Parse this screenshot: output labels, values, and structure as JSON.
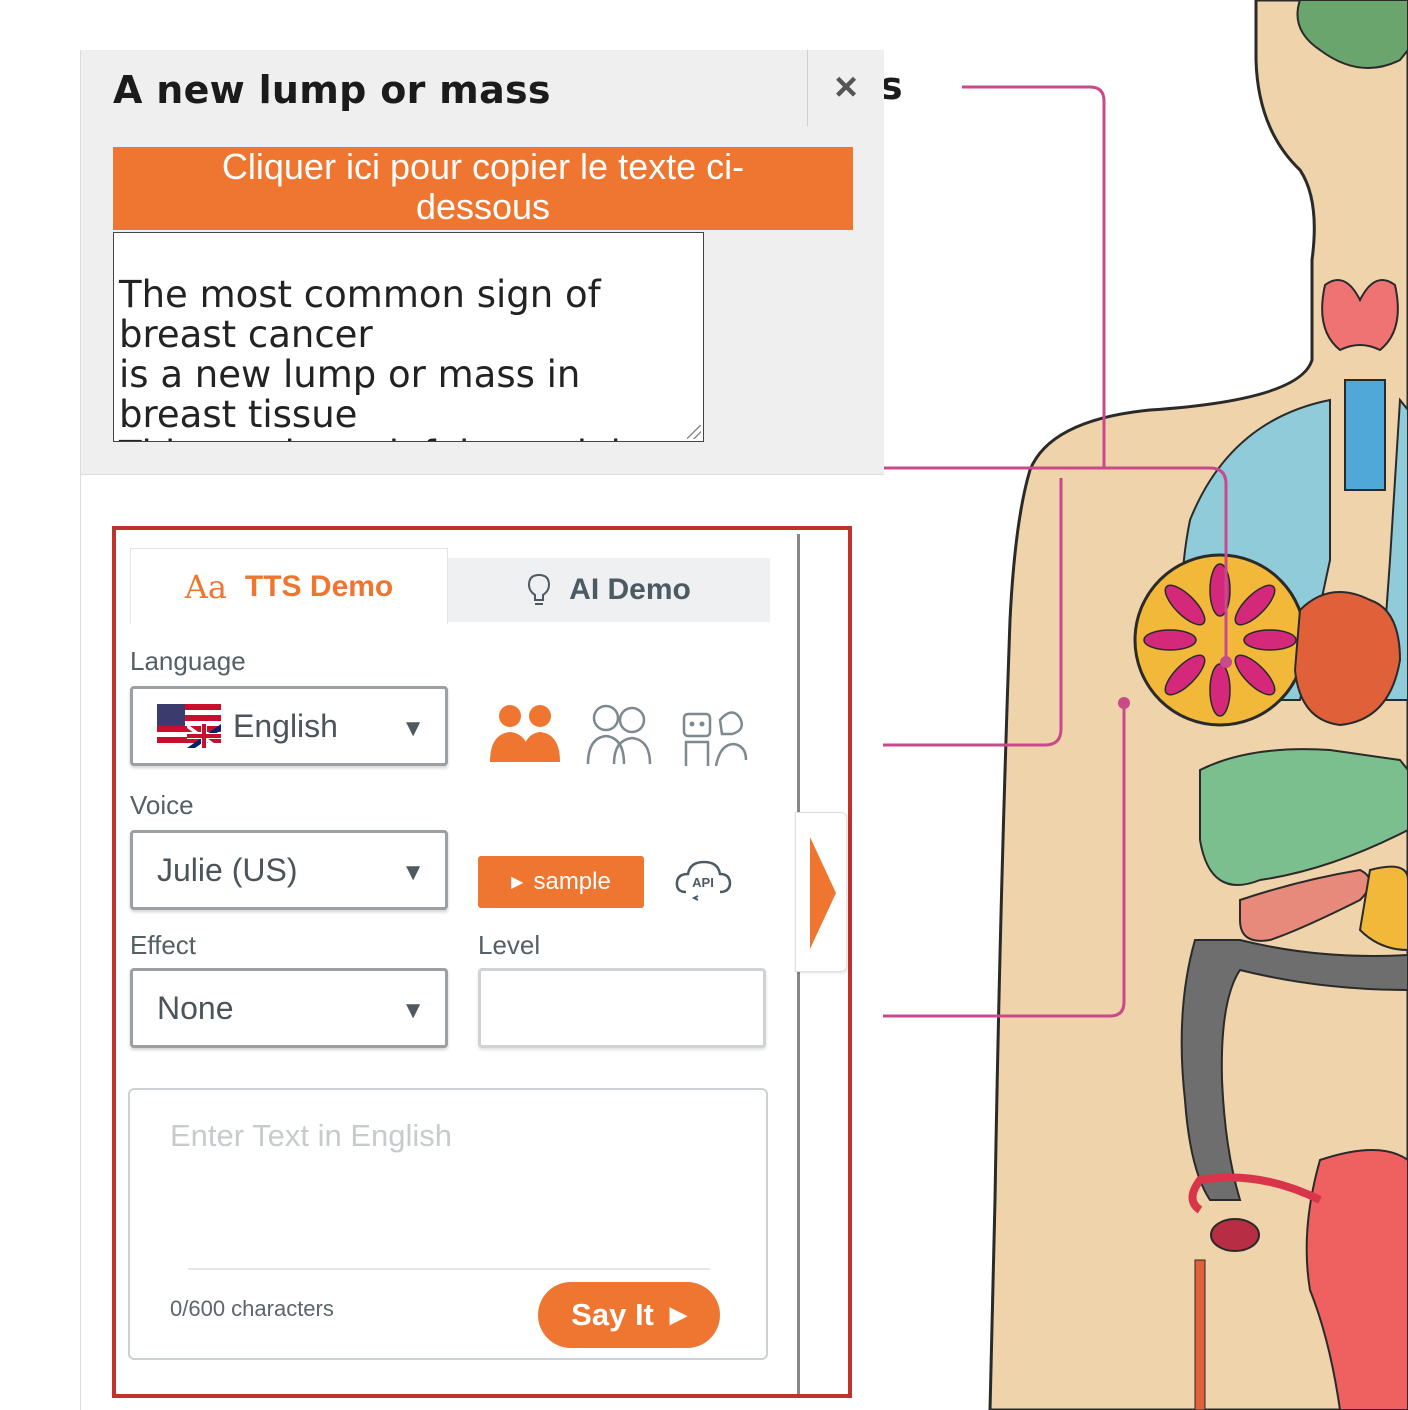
{
  "popup": {
    "title": "A new lump or mass",
    "close_label": "×",
    "copy_button_label": "Cliquer ici pour copier le texte ci-dessous",
    "copy_text": "The most common sign of breast cancer\nis a new lump or mass in breast tissue\nThis can be painful or painless."
  },
  "background_fragment": "s",
  "widget": {
    "tabs": [
      {
        "label": "TTS Demo",
        "icon": "font-aa-icon",
        "active": true
      },
      {
        "label": "AI Demo",
        "icon": "lightbulb-icon",
        "active": false
      }
    ],
    "language": {
      "label": "Language",
      "value": "English",
      "flag": "us-uk-flag-icon"
    },
    "voice": {
      "label": "Voice",
      "value": "Julie (US)"
    },
    "effect": {
      "label": "Effect",
      "value": "None"
    },
    "level": {
      "label": "Level",
      "value": ""
    },
    "voice_group_icons": [
      "adult-voices-icon",
      "child-voices-icon",
      "character-voices-icon"
    ],
    "sample_button": {
      "label": "sample",
      "icon": "play-icon"
    },
    "api_icon_text": "API",
    "text_input": {
      "placeholder": "Enter Text in English",
      "value": ""
    },
    "char_count": "0/600 characters",
    "say_it_button": "Say It"
  },
  "colors": {
    "accent_orange": "#ee7630",
    "highlight_red": "#c0322a",
    "header_gray": "#efefef",
    "skin": "#efd3aa",
    "connector_pink": "#c94a8c"
  }
}
